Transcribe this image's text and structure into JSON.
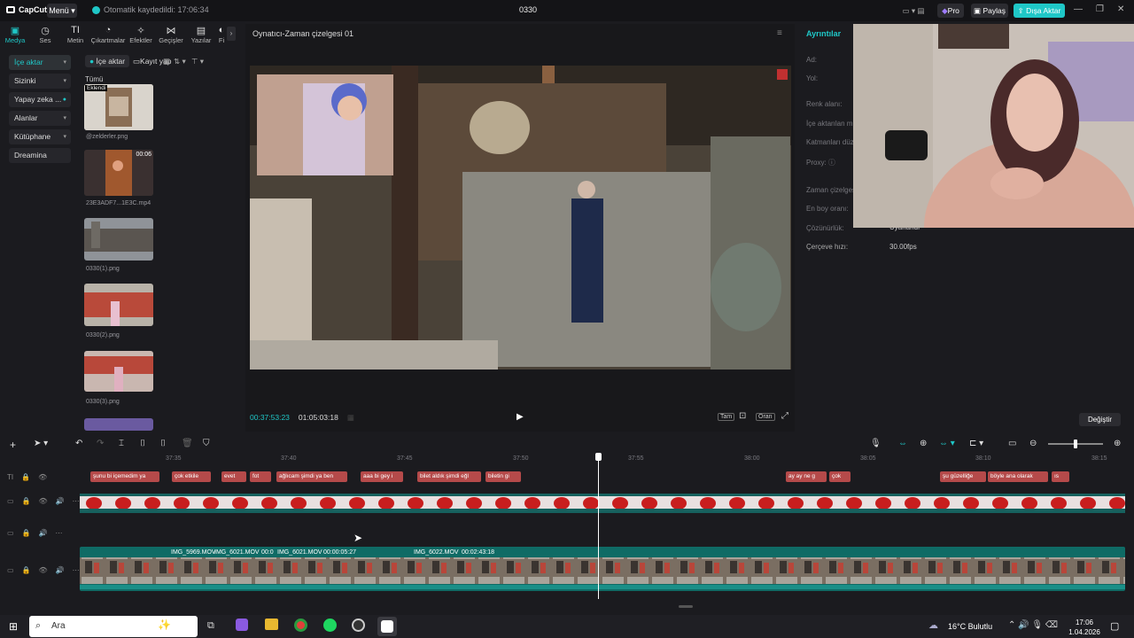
{
  "app": {
    "logo_text": "CapCut",
    "menu_label": "Menü",
    "autosave_text": "Otomatik kaydedildi: 17:06:34",
    "project_title": "0330",
    "pro_label": "Pro",
    "share_label": "Paylaş",
    "export_label": "Dışa Aktar"
  },
  "tooltabs": [
    {
      "label": "Medya",
      "icon": "media-icon"
    },
    {
      "label": "Ses",
      "icon": "audio-icon"
    },
    {
      "label": "Metin",
      "icon": "text-icon"
    },
    {
      "label": "Çıkartmalar",
      "icon": "sticker-icon"
    },
    {
      "label": "Efektler",
      "icon": "effects-icon"
    },
    {
      "label": "Geçişler",
      "icon": "transition-icon"
    },
    {
      "label": "Yazılar",
      "icon": "captions-icon"
    },
    {
      "label": "Fi",
      "icon": "filter-icon"
    }
  ],
  "leftnav": [
    {
      "label": "İçe aktar",
      "active": true
    },
    {
      "label": "Sizinki"
    },
    {
      "label": "Yapay zeka ..."
    },
    {
      "label": "Alanlar"
    },
    {
      "label": "Kütüphane"
    },
    {
      "label": "Dreamina"
    }
  ],
  "media": {
    "import_label": "İçe aktar",
    "record_label": "Kayıt yap",
    "all_label": "Tümü",
    "items": [
      {
        "name": "@zelderler.png",
        "badge": "Eklendi"
      },
      {
        "name": "23E3ADF7...1E3C.mp4",
        "duration": "00:06"
      },
      {
        "name": "0330(1).png"
      },
      {
        "name": "0330(2).png"
      },
      {
        "name": "0330(3).png"
      }
    ]
  },
  "player": {
    "title": "Oynatıcı-Zaman çizelgesi 01",
    "current_time": "00:37:53:23",
    "total_time": "01:05:03:18",
    "full_label": "Tam",
    "ratio_label": "Oran"
  },
  "details": {
    "header": "Ayrıntılar",
    "fields": [
      "Ad:",
      "Yol:",
      "Renk alanı:",
      "İçe aktarılan m...",
      "Katmanları düz...",
      "Proxy:",
      "Zaman çizelgesi...",
      "En boy oranı:",
      "Çözünürlük:",
      "Çerçeve hızı:"
    ],
    "resolution_value": "Uyarlandı",
    "framerate_value": "30.00fps",
    "modify_label": "Değiştir"
  },
  "timeline": {
    "ticks": [
      "37:35",
      "37:40",
      "37:45",
      "37:50",
      "37:55",
      "38:00",
      "38:05",
      "38:10",
      "38:15"
    ],
    "text_clips": [
      "şunu bi içemedim ya",
      "çok etkile",
      "evet",
      "fot",
      "ağlıcam şimdi ya ben",
      "aaa bi gey i",
      "bilet aldık şimdi eğl",
      "biletin gi",
      "ay ay ne g",
      "çok",
      "şu güzelliğe",
      "böyle ana olarak",
      "ıs"
    ],
    "video_labels": [
      "IMG_5969.MOV",
      "IMG_6021.MOV",
      "00:0",
      "IMG_6021.MOV",
      "00:00:05:27",
      "IMG_6022.MOV",
      "00:02:43:18"
    ]
  },
  "taskbar": {
    "search_placeholder": "Ara",
    "weather": "16°C Bulutlu",
    "time": "17:06",
    "date": "1.04.2026"
  }
}
